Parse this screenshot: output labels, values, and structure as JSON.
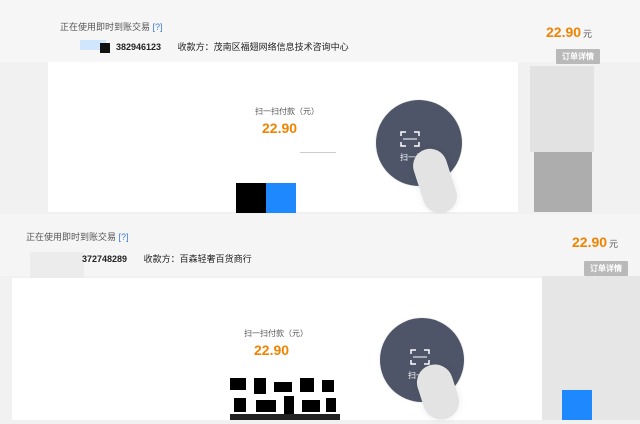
{
  "colors": {
    "accent": "#f08400",
    "link": "#3c78d8",
    "scan_circle": "#4e5568",
    "detail_button": "#b9b9b9",
    "mosaic_blue": "#1e88ff"
  },
  "top": {
    "status_text": "正在使用即时到账交易",
    "status_help": "[?]",
    "order_number": "382946123",
    "payee": "收款方：茂南区福翅网络信息技术咨询中心",
    "amount": "22.90",
    "unit": "元",
    "detail_button": "订单详情",
    "scan_label": "扫一扫付款（元）",
    "scan_amount": "22.90",
    "scan_button_text": "扫一扫"
  },
  "bottom": {
    "status_text": "正在使用即时到账交易",
    "status_help": "[?]",
    "order_number": "372748289",
    "payee": "收款方：百森轻奢百货商行",
    "amount": "22.90",
    "unit": "元",
    "detail_button": "订单详情",
    "scan_label": "扫一扫付款（元）",
    "scan_amount": "22.90",
    "scan_button_text": "扫一扫"
  },
  "icons": {
    "scan_icon": "scan-frame-icon"
  }
}
